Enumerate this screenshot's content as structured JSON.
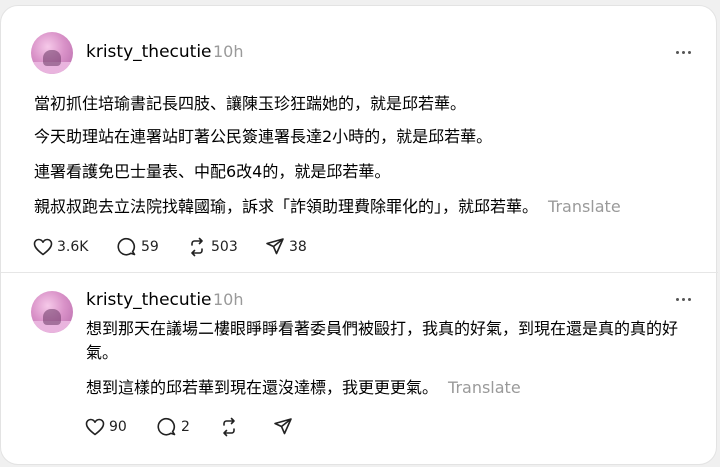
{
  "posts": [
    {
      "username": "kristy_thecutie",
      "time": "10h",
      "paragraphs": [
        "當初抓住培瑜書記長四肢、讓陳玉珍狂踹她的，就是邱若華。",
        "今天助理站在連署站盯著公民簽連署長達2小時的，就是邱若華。",
        "連署看護免巴士量表、中配6改4的，就是邱若華。",
        "親叔叔跑去立法院找韓國瑜，訴求「詐領助理費除罪化的」，就邱若華。"
      ],
      "translate": "Translate",
      "actions": {
        "likes": "3.6K",
        "replies": "59",
        "reposts": "503",
        "shares": "38"
      }
    },
    {
      "username": "kristy_thecutie",
      "time": "10h",
      "paragraphs": [
        "想到那天在議場二樓眼睜睜看著委員們被毆打，我真的好氣，到現在還是真的真的好氣。",
        "想到這樣的邱若華到現在還沒達標，我更更更氣。"
      ],
      "translate": "Translate",
      "actions": {
        "likes": "90",
        "replies": "2",
        "reposts": "",
        "shares": ""
      }
    }
  ]
}
